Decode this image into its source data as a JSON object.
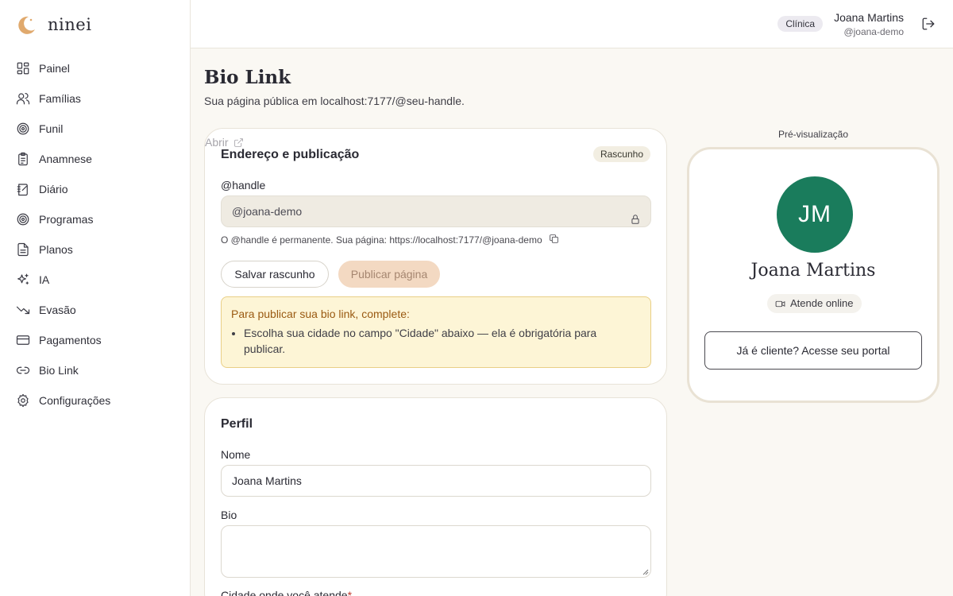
{
  "brand": {
    "name": "ninei",
    "logo_icon": "crescent-moon-icon",
    "accent": "#e0a96d"
  },
  "sidebar": {
    "items": [
      {
        "label": "Painel",
        "icon": "dashboard-icon"
      },
      {
        "label": "Famílias",
        "icon": "users-icon"
      },
      {
        "label": "Funil",
        "icon": "target-icon"
      },
      {
        "label": "Anamnese",
        "icon": "clipboard-icon"
      },
      {
        "label": "Diário",
        "icon": "notebook-icon"
      },
      {
        "label": "Programas",
        "icon": "target-icon"
      },
      {
        "label": "Planos",
        "icon": "file-icon"
      },
      {
        "label": "IA",
        "icon": "sparkles-icon"
      },
      {
        "label": "Evasão",
        "icon": "trend-down-icon"
      },
      {
        "label": "Pagamentos",
        "icon": "credit-card-icon"
      },
      {
        "label": "Bio Link",
        "icon": "link-icon"
      },
      {
        "label": "Configurações",
        "icon": "gear-icon"
      }
    ]
  },
  "header": {
    "role_badge": "Clínica",
    "user_name": "Joana Martins",
    "user_handle": "@joana-demo"
  },
  "main": {
    "title": "Bio Link",
    "subtitle": "Sua página pública em localhost:7177/@seu-handle."
  },
  "publication": {
    "title": "Endereço e publicação",
    "status_badge": "Rascunho",
    "handle_label": "@handle",
    "handle_value": "@joana-demo",
    "hint": "O @handle é permanente. Sua página: https://localhost:7177/@joana-demo",
    "save_label": "Salvar rascunho",
    "publish_label": "Publicar página",
    "open_label": "Abrir",
    "alert_title": "Para publicar sua bio link, complete:",
    "alert_items": [
      "Escolha sua cidade no campo \"Cidade\" abaixo — ela é obrigatória para publicar."
    ]
  },
  "profile": {
    "title": "Perfil",
    "name_label": "Nome",
    "name_value": "Joana Martins",
    "bio_label": "Bio",
    "bio_value": "",
    "city_label": "Cidade onde você atende",
    "city_required_mark": "*"
  },
  "preview": {
    "title": "Pré-visualização",
    "avatar_initials": "JM",
    "avatar_color": "#1a7c5c",
    "name": "Joana Martins",
    "chip": "Atende online",
    "portal_button": "Já é cliente? Acesse seu portal"
  }
}
